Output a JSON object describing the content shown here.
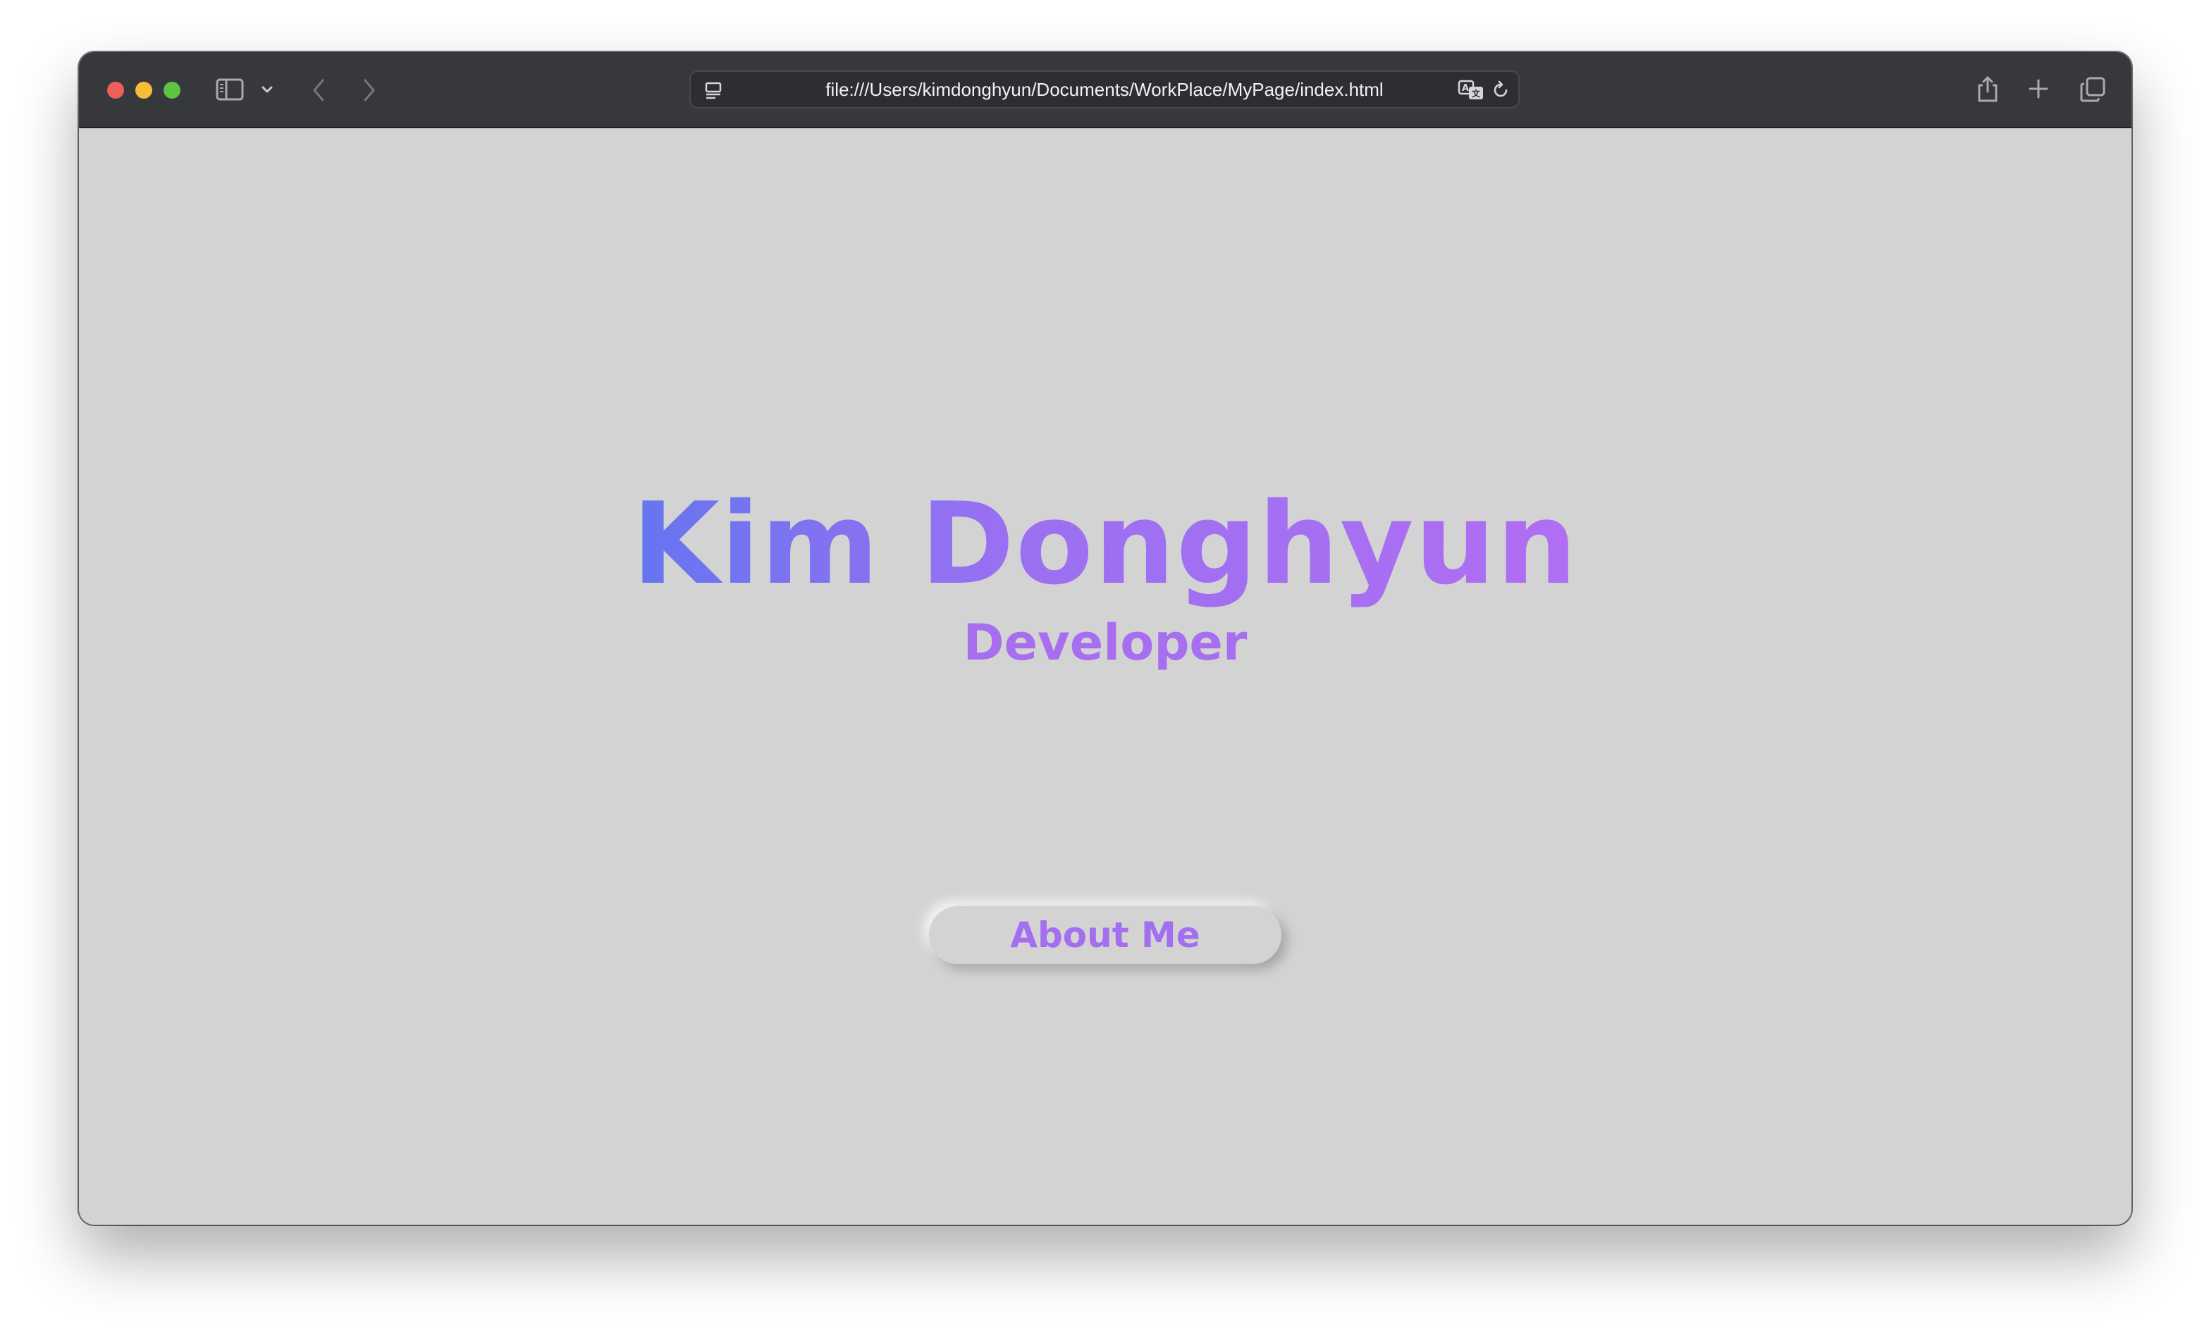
{
  "browser": {
    "url": "file:///Users/kimdonghyun/Documents/WorkPlace/MyPage/index.html",
    "icons": {
      "sidebar": "sidebar-icon",
      "chevron": "chevron-down-icon",
      "back": "back-arrow-icon",
      "forward": "forward-arrow-icon",
      "page": "page-settings-icon",
      "translate": "translate-icon",
      "reload": "reload-icon",
      "share": "share-icon",
      "new_tab": "plus-icon",
      "tabs": "tab-overview-icon"
    },
    "colors": {
      "toolbar": "#37383c",
      "traffic_close": "#ee5f58",
      "traffic_minimize": "#f6bd3b",
      "traffic_maximize": "#5dc442"
    }
  },
  "page": {
    "name": "Kim Donghyun",
    "role": "Developer",
    "about_button": "About Me",
    "colors": {
      "background": "#d3d3d3",
      "gradient_start": "#6675f0",
      "gradient_end": "#b06ef3",
      "accent": "#a36ef0"
    }
  }
}
